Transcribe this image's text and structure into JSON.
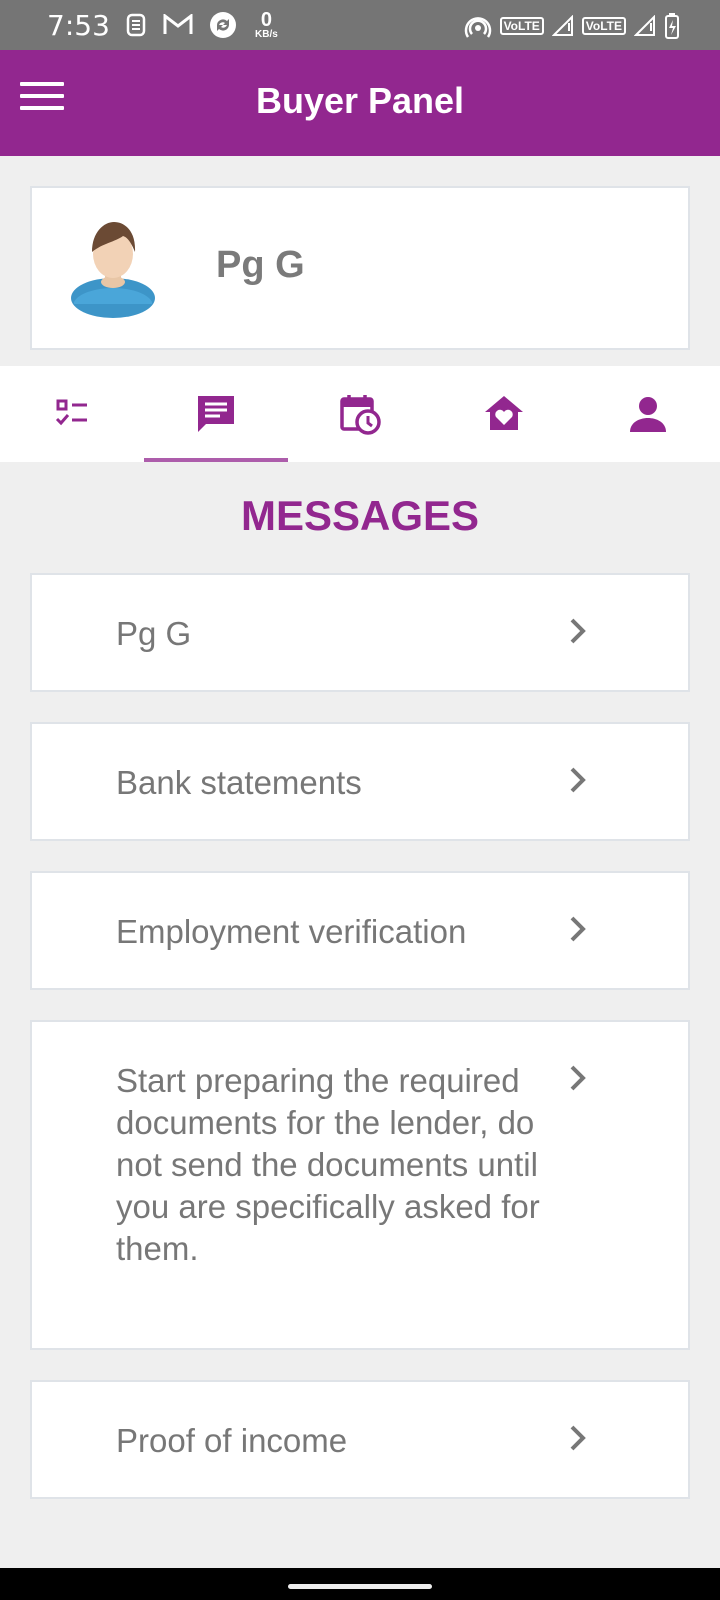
{
  "status_bar": {
    "time": "7:53",
    "network_speed_value": "0",
    "network_speed_unit": "KB/s",
    "volte_1": "VoLTE",
    "volte_2": "VoLTE"
  },
  "app_bar": {
    "title": "Buyer Panel",
    "menu_icon": "hamburger-menu-icon",
    "color": "#92278f"
  },
  "profile": {
    "name": "Pg G",
    "avatar_icon": "user-avatar-icon"
  },
  "tabs": [
    {
      "icon": "checklist-icon",
      "active": false
    },
    {
      "icon": "message-icon",
      "active": true
    },
    {
      "icon": "calendar-clock-icon",
      "active": false
    },
    {
      "icon": "home-heart-icon",
      "active": false
    },
    {
      "icon": "person-icon",
      "active": false
    }
  ],
  "section": {
    "title": "MESSAGES"
  },
  "messages": [
    {
      "label": "Pg G"
    },
    {
      "label": "Bank statements"
    },
    {
      "label": "Employment verification"
    },
    {
      "label": "Start preparing the required documents for the lender, do not send the documents until you are specifically asked for them."
    },
    {
      "label": "Proof of income"
    }
  ],
  "colors": {
    "accent": "#92278f",
    "background": "#efefef",
    "text_gray": "#777777"
  }
}
